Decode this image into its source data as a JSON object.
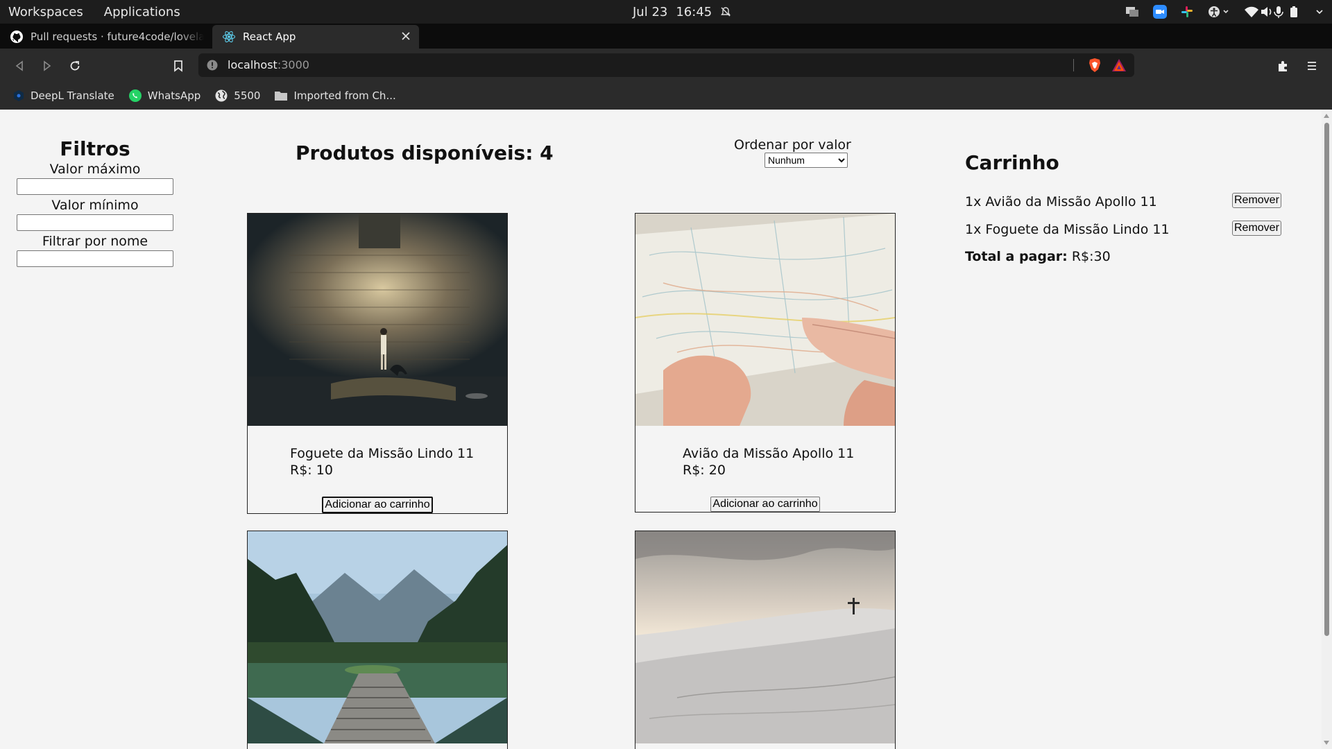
{
  "system_bar": {
    "workspaces": "Workspaces",
    "applications": "Applications",
    "date": "Jul 23",
    "time": "16:45"
  },
  "tabs": [
    {
      "title": "Pull requests · future4code/lovela",
      "active": false
    },
    {
      "title": "React App",
      "active": true
    }
  ],
  "address": {
    "host": "localhost",
    "port": ":3000"
  },
  "bookmarks": [
    {
      "label": "DeepL Translate",
      "icon": "deepl-icon"
    },
    {
      "label": "WhatsApp",
      "icon": "whatsapp-icon"
    },
    {
      "label": "5500",
      "icon": "globe-icon"
    },
    {
      "label": "Imported from Ch...",
      "icon": "folder-icon"
    }
  ],
  "filters": {
    "title": "Filtros",
    "max_label": "Valor máximo",
    "min_label": "Valor mínimo",
    "name_label": "Filtrar por nome",
    "max_value": "",
    "min_value": "",
    "name_value": ""
  },
  "products_header": {
    "title": "Produtos disponíveis: 4"
  },
  "sort": {
    "label": "Ordenar por valor",
    "selected": "Nunhum"
  },
  "products": [
    {
      "name": "Foguete da Missão Lindo 11",
      "price": "R$: 10",
      "button": "Adicionar ao carrinho",
      "image": "child-with-dog-by-wall"
    },
    {
      "name": "Avião da Missão Apollo 11",
      "price": "R$: 20",
      "button": "Adicionar ao carrinho",
      "image": "hands-holding-map"
    },
    {
      "name": "",
      "price": "",
      "button": "",
      "image": "mountain-lake-pier"
    },
    {
      "name": "",
      "price": "",
      "button": "",
      "image": "snowy-hill-cross"
    }
  ],
  "cart": {
    "title": "Carrinho",
    "items": [
      {
        "label": "1x Avião da Missão Apollo 11",
        "button": "Remover"
      },
      {
        "label": "1x Foguete da Missão Lindo 11",
        "button": "Remover"
      }
    ],
    "total_label": "Total a pagar:",
    "total_value": "R$:30"
  }
}
